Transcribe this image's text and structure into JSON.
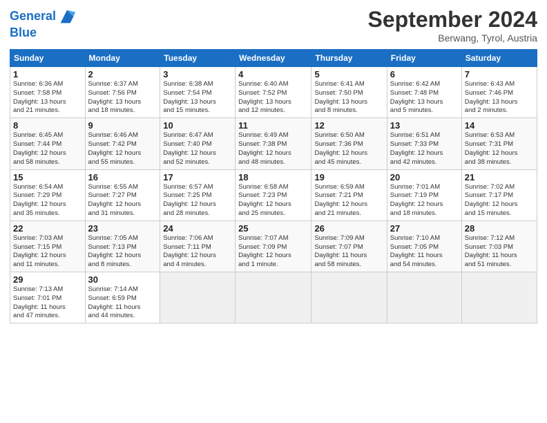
{
  "logo": {
    "line1": "General",
    "line2": "Blue"
  },
  "title": "September 2024",
  "location": "Berwang, Tyrol, Austria",
  "headers": [
    "Sunday",
    "Monday",
    "Tuesday",
    "Wednesday",
    "Thursday",
    "Friday",
    "Saturday"
  ],
  "weeks": [
    [
      {
        "day": "1",
        "info": "Sunrise: 6:36 AM\nSunset: 7:58 PM\nDaylight: 13 hours\nand 21 minutes."
      },
      {
        "day": "2",
        "info": "Sunrise: 6:37 AM\nSunset: 7:56 PM\nDaylight: 13 hours\nand 18 minutes."
      },
      {
        "day": "3",
        "info": "Sunrise: 6:38 AM\nSunset: 7:54 PM\nDaylight: 13 hours\nand 15 minutes."
      },
      {
        "day": "4",
        "info": "Sunrise: 6:40 AM\nSunset: 7:52 PM\nDaylight: 13 hours\nand 12 minutes."
      },
      {
        "day": "5",
        "info": "Sunrise: 6:41 AM\nSunset: 7:50 PM\nDaylight: 13 hours\nand 8 minutes."
      },
      {
        "day": "6",
        "info": "Sunrise: 6:42 AM\nSunset: 7:48 PM\nDaylight: 13 hours\nand 5 minutes."
      },
      {
        "day": "7",
        "info": "Sunrise: 6:43 AM\nSunset: 7:46 PM\nDaylight: 13 hours\nand 2 minutes."
      }
    ],
    [
      {
        "day": "8",
        "info": "Sunrise: 6:45 AM\nSunset: 7:44 PM\nDaylight: 12 hours\nand 58 minutes."
      },
      {
        "day": "9",
        "info": "Sunrise: 6:46 AM\nSunset: 7:42 PM\nDaylight: 12 hours\nand 55 minutes."
      },
      {
        "day": "10",
        "info": "Sunrise: 6:47 AM\nSunset: 7:40 PM\nDaylight: 12 hours\nand 52 minutes."
      },
      {
        "day": "11",
        "info": "Sunrise: 6:49 AM\nSunset: 7:38 PM\nDaylight: 12 hours\nand 48 minutes."
      },
      {
        "day": "12",
        "info": "Sunrise: 6:50 AM\nSunset: 7:36 PM\nDaylight: 12 hours\nand 45 minutes."
      },
      {
        "day": "13",
        "info": "Sunrise: 6:51 AM\nSunset: 7:33 PM\nDaylight: 12 hours\nand 42 minutes."
      },
      {
        "day": "14",
        "info": "Sunrise: 6:53 AM\nSunset: 7:31 PM\nDaylight: 12 hours\nand 38 minutes."
      }
    ],
    [
      {
        "day": "15",
        "info": "Sunrise: 6:54 AM\nSunset: 7:29 PM\nDaylight: 12 hours\nand 35 minutes."
      },
      {
        "day": "16",
        "info": "Sunrise: 6:55 AM\nSunset: 7:27 PM\nDaylight: 12 hours\nand 31 minutes."
      },
      {
        "day": "17",
        "info": "Sunrise: 6:57 AM\nSunset: 7:25 PM\nDaylight: 12 hours\nand 28 minutes."
      },
      {
        "day": "18",
        "info": "Sunrise: 6:58 AM\nSunset: 7:23 PM\nDaylight: 12 hours\nand 25 minutes."
      },
      {
        "day": "19",
        "info": "Sunrise: 6:59 AM\nSunset: 7:21 PM\nDaylight: 12 hours\nand 21 minutes."
      },
      {
        "day": "20",
        "info": "Sunrise: 7:01 AM\nSunset: 7:19 PM\nDaylight: 12 hours\nand 18 minutes."
      },
      {
        "day": "21",
        "info": "Sunrise: 7:02 AM\nSunset: 7:17 PM\nDaylight: 12 hours\nand 15 minutes."
      }
    ],
    [
      {
        "day": "22",
        "info": "Sunrise: 7:03 AM\nSunset: 7:15 PM\nDaylight: 12 hours\nand 11 minutes."
      },
      {
        "day": "23",
        "info": "Sunrise: 7:05 AM\nSunset: 7:13 PM\nDaylight: 12 hours\nand 8 minutes."
      },
      {
        "day": "24",
        "info": "Sunrise: 7:06 AM\nSunset: 7:11 PM\nDaylight: 12 hours\nand 4 minutes."
      },
      {
        "day": "25",
        "info": "Sunrise: 7:07 AM\nSunset: 7:09 PM\nDaylight: 12 hours\nand 1 minute."
      },
      {
        "day": "26",
        "info": "Sunrise: 7:09 AM\nSunset: 7:07 PM\nDaylight: 11 hours\nand 58 minutes."
      },
      {
        "day": "27",
        "info": "Sunrise: 7:10 AM\nSunset: 7:05 PM\nDaylight: 11 hours\nand 54 minutes."
      },
      {
        "day": "28",
        "info": "Sunrise: 7:12 AM\nSunset: 7:03 PM\nDaylight: 11 hours\nand 51 minutes."
      }
    ],
    [
      {
        "day": "29",
        "info": "Sunrise: 7:13 AM\nSunset: 7:01 PM\nDaylight: 11 hours\nand 47 minutes."
      },
      {
        "day": "30",
        "info": "Sunrise: 7:14 AM\nSunset: 6:59 PM\nDaylight: 11 hours\nand 44 minutes."
      },
      {
        "day": "",
        "info": ""
      },
      {
        "day": "",
        "info": ""
      },
      {
        "day": "",
        "info": ""
      },
      {
        "day": "",
        "info": ""
      },
      {
        "day": "",
        "info": ""
      }
    ]
  ]
}
